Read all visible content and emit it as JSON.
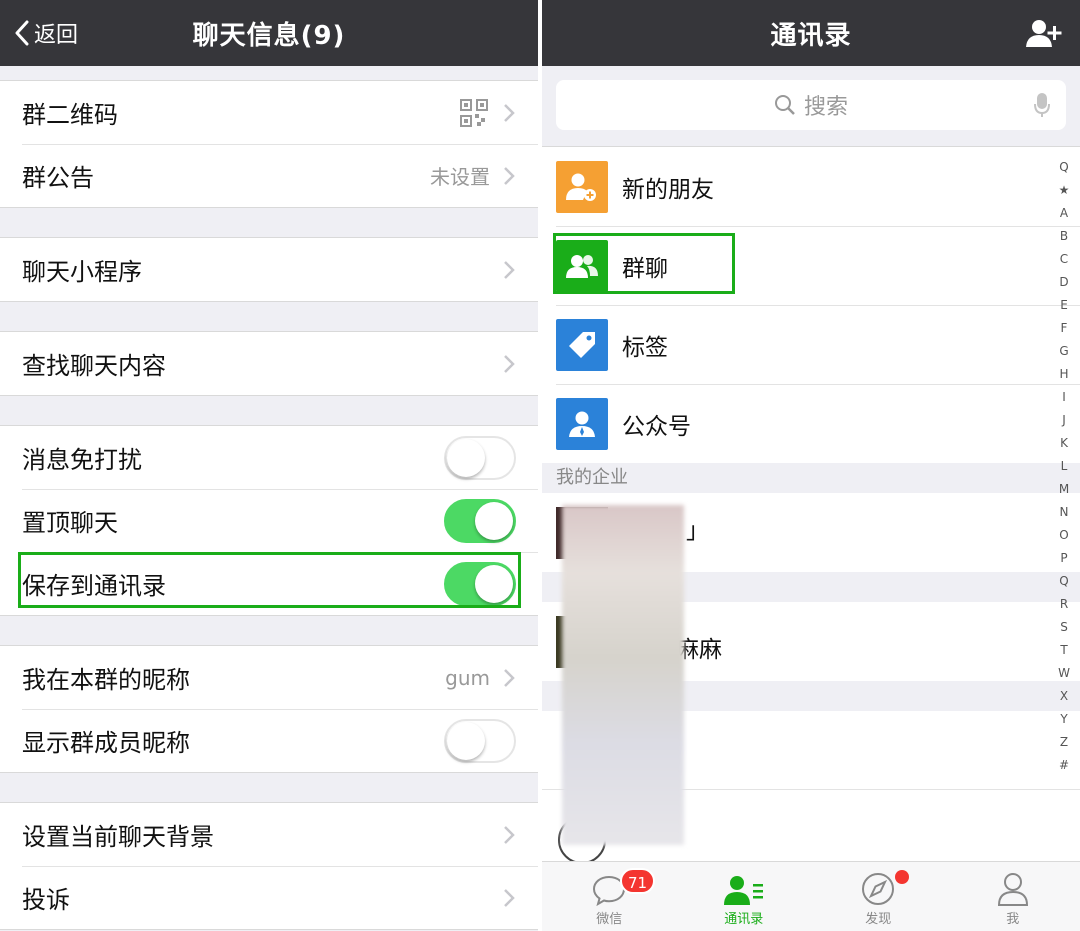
{
  "left": {
    "nav": {
      "back_label": "返回",
      "title": "聊天信息(9)"
    },
    "rows": {
      "qrcode": {
        "label": "群二维码"
      },
      "notice": {
        "label": "群公告",
        "value": "未设置"
      },
      "miniprogram": {
        "label": "聊天小程序"
      },
      "search_content": {
        "label": "查找聊天内容"
      },
      "mute": {
        "label": "消息免打扰",
        "on": false
      },
      "pin": {
        "label": "置顶聊天",
        "on": true
      },
      "save_contacts": {
        "label": "保存到通讯录",
        "on": true
      },
      "my_nickname": {
        "label": "我在本群的昵称",
        "value": "gum"
      },
      "show_nicknames": {
        "label": "显示群成员昵称",
        "on": false
      },
      "background": {
        "label": "设置当前聊天背景"
      },
      "report": {
        "label": "投诉"
      }
    }
  },
  "right": {
    "nav": {
      "title": "通讯录"
    },
    "search": {
      "placeholder": "搜索"
    },
    "entries": {
      "new_friends": {
        "label": "新的朋友",
        "color": "#f5a033"
      },
      "group_chats": {
        "label": "群聊",
        "color": "#1aad19"
      },
      "tags": {
        "label": "标签",
        "color": "#2b82d9"
      },
      "official": {
        "label": "公众号",
        "color": "#2b82d9"
      }
    },
    "section_enterprise": "我的企业",
    "blurred_partial": {
      "text1": "」",
      "text2": "麻麻"
    },
    "index": [
      "Q",
      "★",
      "A",
      "B",
      "C",
      "D",
      "E",
      "F",
      "G",
      "H",
      "I",
      "J",
      "K",
      "L",
      "M",
      "N",
      "O",
      "P",
      "Q",
      "R",
      "S",
      "T",
      "W",
      "X",
      "Y",
      "Z",
      "#"
    ],
    "tabs": {
      "chats": {
        "label": "微信",
        "badge": "71"
      },
      "contacts": {
        "label": "通讯录"
      },
      "discover": {
        "label": "发现"
      },
      "me": {
        "label": "我"
      }
    },
    "colors": {
      "accent": "#1aad19",
      "badge": "#f43530"
    }
  }
}
